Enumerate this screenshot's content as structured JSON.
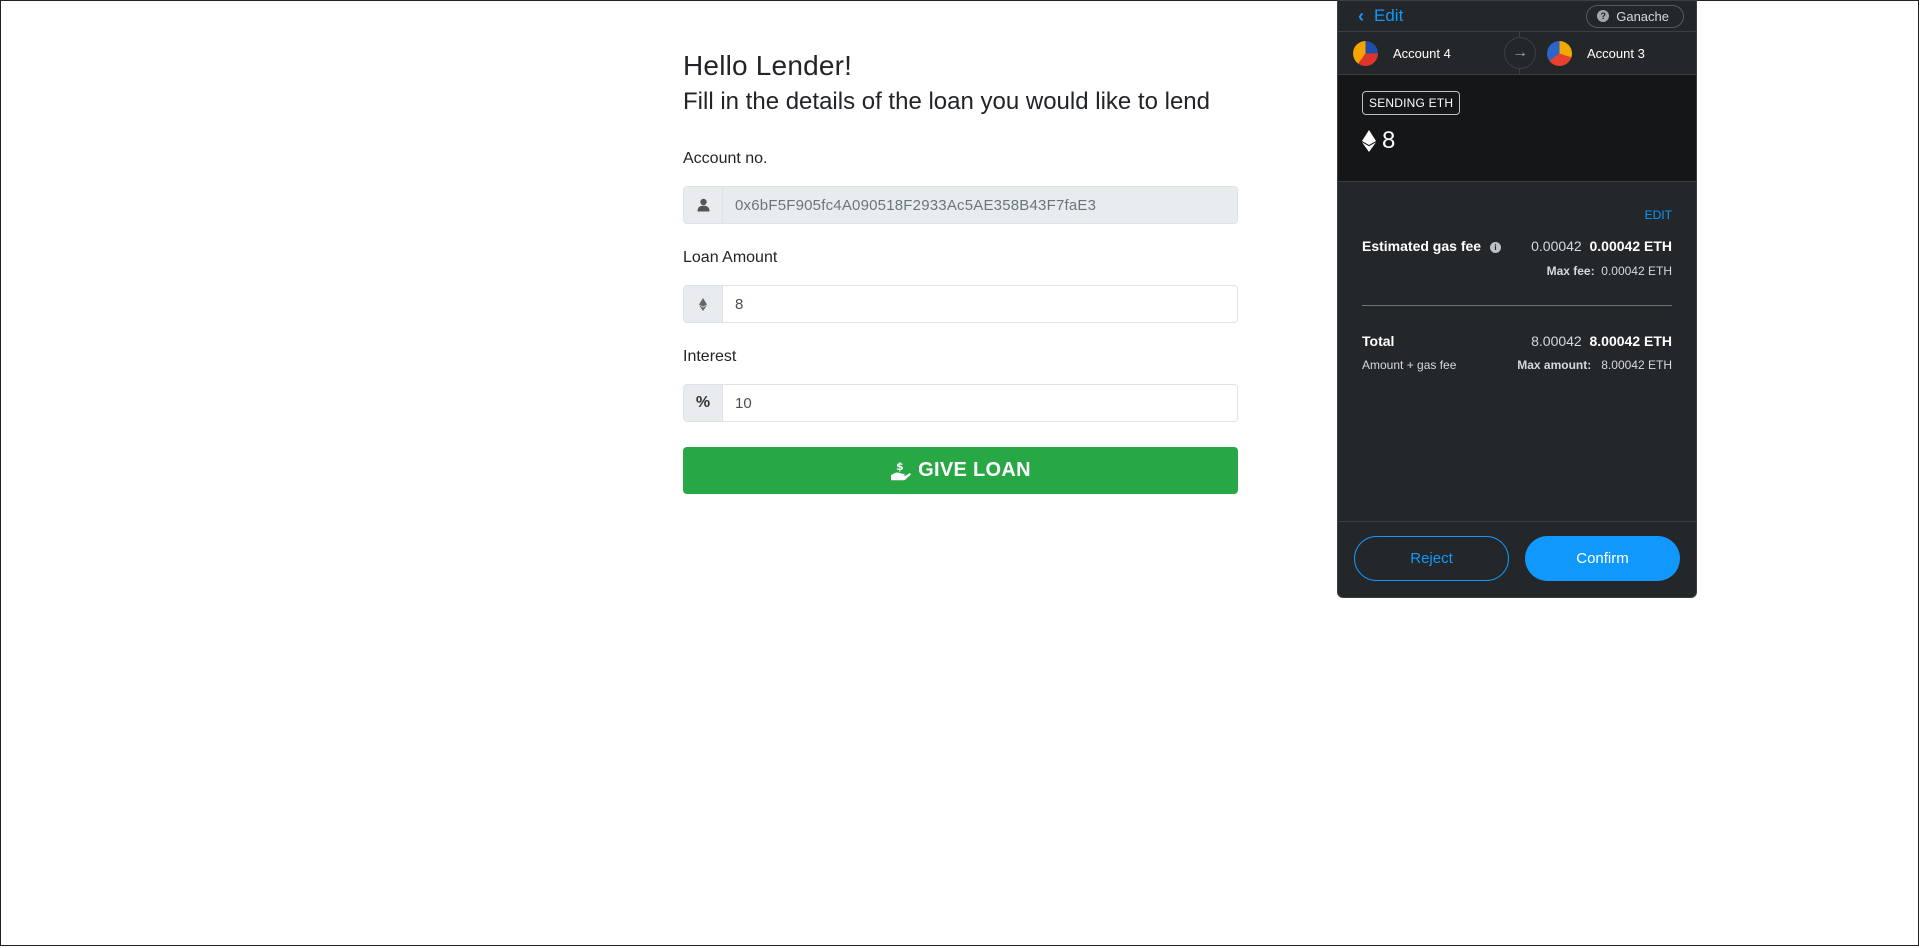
{
  "form": {
    "greeting": "Hello Lender!",
    "instruction": "Fill in the details of the loan you would like to lend",
    "account": {
      "label": "Account no.",
      "value": "0x6bF5F905fc4A090518F2933Ac5AE358B43F7faE3",
      "icon": "user-icon"
    },
    "loan_amount": {
      "label": "Loan Amount",
      "value": "8",
      "icon": "ethereum-icon"
    },
    "interest": {
      "label": "Interest",
      "value": "10",
      "prefix": "%"
    },
    "submit_label": "GIVE LOAN",
    "submit_color": "#28a745"
  },
  "wallet": {
    "back_label": "Edit",
    "network": "Ganache",
    "from_account": "Account 4",
    "to_account": "Account 3",
    "badge": "SENDING ETH",
    "amount": "8",
    "edit_label": "EDIT",
    "gas_fee_label": "Estimated gas fee",
    "gas_fee_value": "0.00042",
    "gas_fee_eth": "0.00042 ETH",
    "max_fee_label": "Max fee:",
    "max_fee_value": "0.00042 ETH",
    "total_label": "Total",
    "total_value": "8.00042",
    "total_eth": "8.00042 ETH",
    "total_sub_label": "Amount + gas fee",
    "max_amount_label": "Max amount:",
    "max_amount_value": "8.00042 ETH",
    "reject_label": "Reject",
    "confirm_label": "Confirm",
    "accent_color": "#1098fc",
    "background_color": "#24272a"
  }
}
